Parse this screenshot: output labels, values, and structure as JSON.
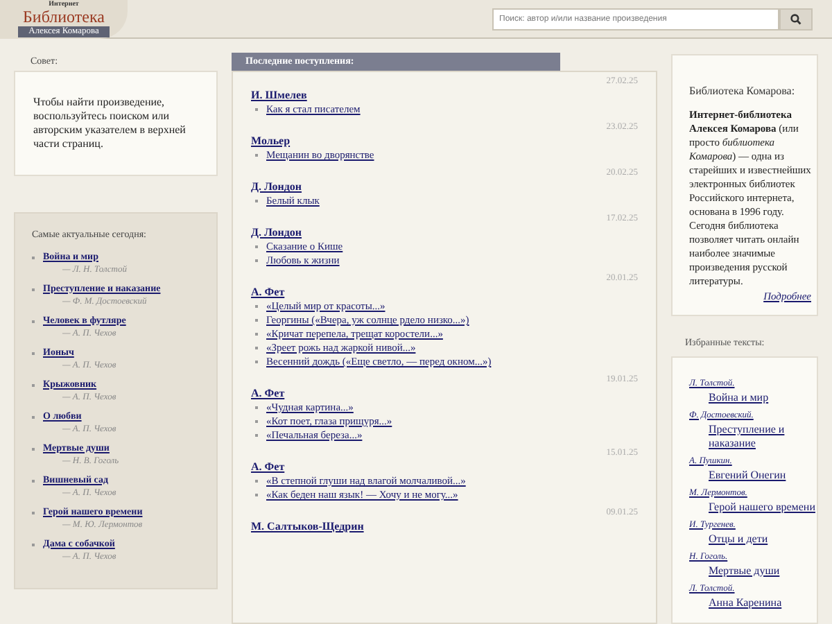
{
  "logo": {
    "top": "Интернет",
    "main": "Библиотека",
    "sub": "Алексея Комарова"
  },
  "search": {
    "placeholder": "Поиск: автор и/или название произведения"
  },
  "tip": {
    "title": "Совет:",
    "text": "Чтобы найти произведение, воспользуйтесь поиском или авторским указателем в верхней части страниц."
  },
  "popular": {
    "title": "Самые актуальные сегодня:",
    "items": [
      {
        "title": "Война и мир",
        "author": "— Л. Н. Толстой"
      },
      {
        "title": "Преступление и наказание",
        "author": "— Ф. М. Достоевский"
      },
      {
        "title": "Человек в футляре",
        "author": "— А. П. Чехов"
      },
      {
        "title": "Ионыч",
        "author": "— А. П. Чехов"
      },
      {
        "title": "Крыжовник",
        "author": "— А. П. Чехов"
      },
      {
        "title": "О любви",
        "author": "— А. П. Чехов"
      },
      {
        "title": "Мертвые души",
        "author": "— Н. В. Гоголь"
      },
      {
        "title": "Вишневый сад",
        "author": "— А. П. Чехов"
      },
      {
        "title": "Герой нашего времени",
        "author": "— М. Ю. Лермонтов"
      },
      {
        "title": "Дама с собачкой",
        "author": "— А. П. Чехов"
      }
    ]
  },
  "latest": {
    "title": "Последние поступления:",
    "entries": [
      {
        "date": "27.02.25",
        "author": "И. Шмелев",
        "works": [
          "Как я стал писателем"
        ]
      },
      {
        "date": "23.02.25",
        "author": "Мольер",
        "works": [
          "Мещанин во дворянстве"
        ]
      },
      {
        "date": "20.02.25",
        "author": "Д. Лондон",
        "works": [
          "Белый клык"
        ]
      },
      {
        "date": "17.02.25",
        "author": "Д. Лондон",
        "works": [
          "Сказание о Кише",
          "Любовь к жизни"
        ]
      },
      {
        "date": "20.01.25",
        "author": "А. Фет",
        "works": [
          "«Целый мир от красоты...»",
          "Георгины («Вчера, уж солнце рдело низко...»)",
          "«Кричат перепела, трещат коростели...»",
          "«Зреет рожь над жаркой нивой...»",
          "Весенний дождь («Еще светло, — перед окном...»)"
        ]
      },
      {
        "date": "19.01.25",
        "author": "А. Фет",
        "works": [
          "«Чудная картина...»",
          "«Кот поет, глаза прищуря...»",
          "«Печальная береза...»"
        ]
      },
      {
        "date": "15.01.25",
        "author": "А. Фет",
        "works": [
          "«В степной глуши над влагой молчаливой...»",
          "«Как беден наш язык! — Хочу и не могу...»"
        ]
      },
      {
        "date": "09.01.25",
        "author": "М. Салтыков-Щедрин"
      }
    ]
  },
  "about": {
    "title": "Библиотека Комарова:",
    "text": "**Интернет-библиотека Алексея Комарова** (или просто *библиотека Комарова*) — одна из старейших и известнейших электронных библиотек Российского интернета, основана в 1996 году. Сегодня библиотека позволяет читать онлайн наиболее значимые произведения русской литературы.",
    "more": "Подробнее"
  },
  "favorites": {
    "title": "Избранные тексты:",
    "items": [
      {
        "author": "Л. Толстой.",
        "title": "Война и мир"
      },
      {
        "author": "Ф. Достоевский.",
        "title": "Преступление и наказание"
      },
      {
        "author": "А. Пушкин.",
        "title": "Евгений Онегин"
      },
      {
        "author": "М. Лермонтов.",
        "title": "Герой нашего времени"
      },
      {
        "author": "И. Тургенев.",
        "title": "Отцы и дети"
      },
      {
        "author": "Н. Гоголь.",
        "title": "Мертвые души"
      },
      {
        "author": "Л. Толстой.",
        "title": "Анна Каренина"
      }
    ]
  }
}
